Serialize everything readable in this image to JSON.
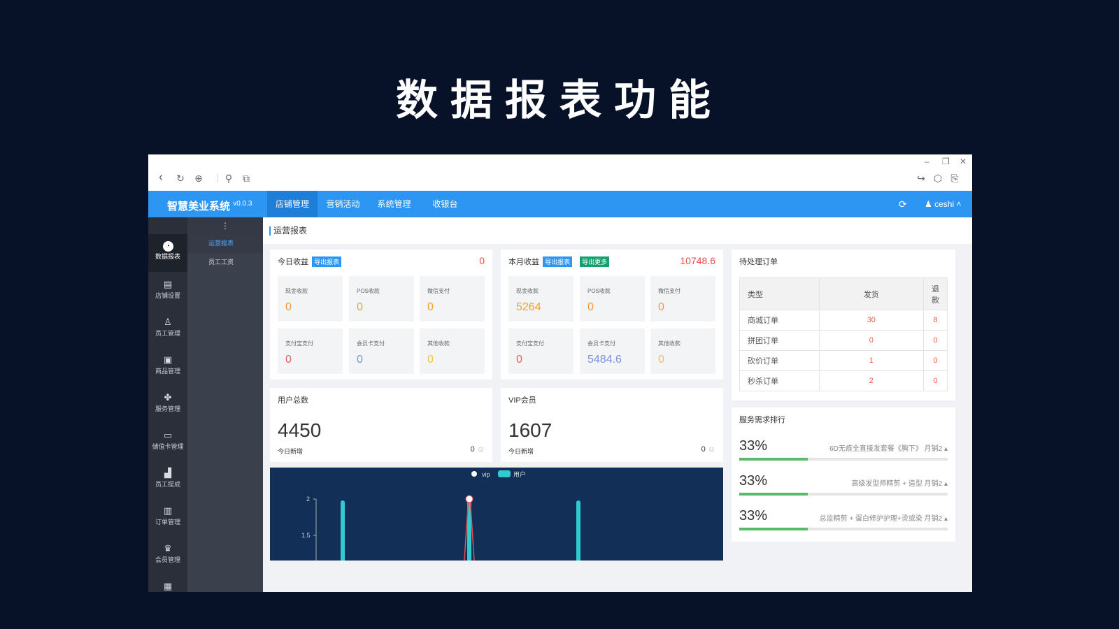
{
  "slide": {
    "title": "数据报表功能"
  },
  "window": {
    "minimize": "–",
    "restore": "❐",
    "close": "✕"
  },
  "toolbar": {
    "back": "‹",
    "refresh": "↻",
    "globe": "⊕",
    "link": "⚲",
    "copy": "⧉",
    "share": "↪",
    "cube": "⬡",
    "doc": "⎘"
  },
  "header": {
    "brand": "智慧美业系统",
    "version": "v0.0.3",
    "nav": [
      "店铺管理",
      "营销活动",
      "系统管理",
      "收银台"
    ],
    "refresh_icon": "⟳",
    "user": "ceshi"
  },
  "sidebar": {
    "toggle": "⋮",
    "items": [
      {
        "label": "数据报表",
        "icon": "◔"
      },
      {
        "label": "店铺设置",
        "icon": "▤"
      },
      {
        "label": "员工管理",
        "icon": "♙"
      },
      {
        "label": "商品管理",
        "icon": "▣"
      },
      {
        "label": "服务管理",
        "icon": "✤"
      },
      {
        "label": "储值卡管理",
        "icon": "▭"
      },
      {
        "label": "员工提成",
        "icon": "▟"
      },
      {
        "label": "订单管理",
        "icon": "▥"
      },
      {
        "label": "会员管理",
        "icon": "♛"
      },
      {
        "label": "",
        "icon": "▦"
      }
    ],
    "sub_items": [
      "运营报表",
      "员工工资"
    ]
  },
  "breadcrumb": "运营报表",
  "today_income": {
    "title": "今日收益",
    "export": "导出报表",
    "total": "0",
    "items": [
      {
        "label": "现金收款",
        "value": "0"
      },
      {
        "label": "POS收款",
        "value": "0"
      },
      {
        "label": "微信支付",
        "value": "0"
      },
      {
        "label": "支付宝支付",
        "value": "0"
      },
      {
        "label": "会员卡支付",
        "value": "0"
      },
      {
        "label": "其他收款",
        "value": "0"
      }
    ]
  },
  "month_income": {
    "title": "本月收益",
    "export": "导出报表",
    "more": "导出更多",
    "total": "10748.6",
    "items": [
      {
        "label": "现金收款",
        "value": "5264"
      },
      {
        "label": "POS收款",
        "value": "0"
      },
      {
        "label": "微信支付",
        "value": "0"
      },
      {
        "label": "支付宝支付",
        "value": "0"
      },
      {
        "label": "会员卡支付",
        "value": "5484.6"
      },
      {
        "label": "其他收款",
        "value": "0"
      }
    ]
  },
  "users": {
    "title": "用户总数",
    "total": "4450",
    "today_label": "今日新增",
    "today_value": "0"
  },
  "vip": {
    "title": "VIP会员",
    "total": "1607",
    "today_label": "今日新增",
    "today_value": "0"
  },
  "chart_data": {
    "type": "line",
    "legend": [
      "vip",
      "用户"
    ],
    "legend_position": "top",
    "y_ticks": [
      "2",
      "1.5"
    ],
    "series": [
      {
        "name": "vip",
        "color": "#ffffff",
        "values_visible": "peak point at 2"
      },
      {
        "name": "用户",
        "color": "#2ecad0",
        "bars_visible": 3
      }
    ]
  },
  "pending_orders": {
    "title": "待处理订单",
    "headers": [
      "类型",
      "发货",
      "退款"
    ],
    "rows": [
      {
        "type": "商城订单",
        "ship": "30",
        "refund": "8"
      },
      {
        "type": "拼团订单",
        "ship": "0",
        "refund": "0"
      },
      {
        "type": "砍价订单",
        "ship": "1",
        "refund": "0"
      },
      {
        "type": "秒杀订单",
        "ship": "2",
        "refund": "0"
      }
    ]
  },
  "service_rank": {
    "title": "服务需求排行",
    "items": [
      {
        "pct": "33%",
        "name": "6D无痕全直接发套餐《胸下》 月销2",
        "fill": 0.33
      },
      {
        "pct": "33%",
        "name": "高级发型师精剪 + 造型 月销2",
        "fill": 0.33
      },
      {
        "pct": "33%",
        "name": "总监精剪 + 蛋白修护护理+烫或染 月销2",
        "fill": 0.33
      }
    ]
  },
  "colors": {
    "primary": "#2d95f2",
    "sidebar": "#2b2f3a",
    "bg": "#071229",
    "chart_bg": "#123057"
  }
}
